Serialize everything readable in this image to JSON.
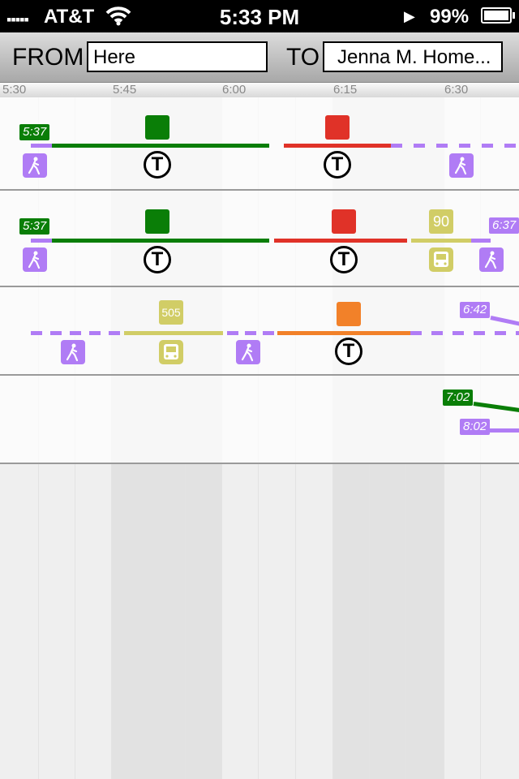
{
  "status_bar": {
    "signal": "▪▪▪▪▪",
    "carrier": "AT&T",
    "time": "5:33 PM",
    "play_icon": "▶",
    "battery": "99%",
    "battery_level": 0.99
  },
  "header": {
    "from_label": "FROM",
    "from_value": "Here",
    "to_label": "TO",
    "to_value": "Jenna M. Home..."
  },
  "ruler": {
    "ticks": [
      "5:30",
      "5:45",
      "6:00",
      "6:15",
      "6:30"
    ]
  },
  "colors": {
    "green_line": "#0a7e07",
    "red_line": "#e03228",
    "orange_line": "#f28129",
    "bus_yellow": "#d1cd66",
    "walk_purple": "#b07cf5",
    "t_icon": "T"
  },
  "itineraries": [
    {
      "start_time": "5:37",
      "legs": [
        "walk",
        "green-line",
        "red-line",
        "walk"
      ],
      "icons": [
        "walk-icon",
        "t-icon",
        "t-icon",
        "walk-icon"
      ]
    },
    {
      "start_time": "5:37",
      "end_time": "6:37",
      "bus_route": "90",
      "legs": [
        "walk",
        "green-line",
        "red-line",
        "bus",
        "walk"
      ],
      "icons": [
        "walk-icon",
        "t-icon",
        "t-icon",
        "bus-icon",
        "walk-icon"
      ]
    },
    {
      "end_time": "6:42",
      "bus_route": "505",
      "legs": [
        "walk",
        "bus",
        "walk",
        "orange-line",
        "walk"
      ],
      "icons": [
        "walk-icon",
        "bus-icon",
        "walk-icon",
        "t-icon"
      ]
    },
    {
      "times": [
        "7:02",
        "8:02"
      ]
    }
  ]
}
